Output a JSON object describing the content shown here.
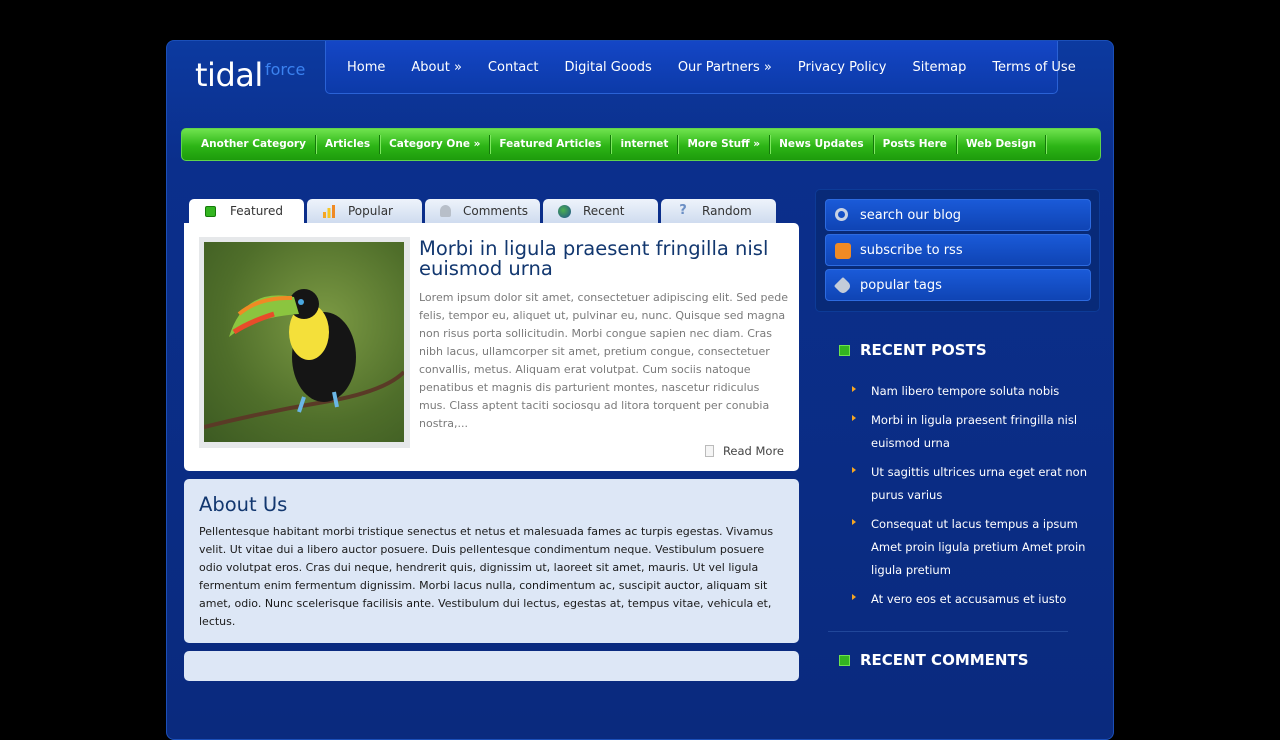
{
  "logo": {
    "main": "tidal",
    "sub": "force"
  },
  "top_nav": [
    "Home",
    "About »",
    "Contact",
    "Digital Goods",
    "Our Partners »",
    "Privacy Policy",
    "Sitemap",
    "Terms of Use"
  ],
  "category_nav": [
    "Another Category",
    "Articles",
    "Category One »",
    "Featured Articles",
    "internet",
    "More Stuff »",
    "News Updates",
    "Posts Here",
    "Web Design"
  ],
  "tabs": [
    "Featured",
    "Popular",
    "Comments",
    "Recent",
    "Random"
  ],
  "featured": {
    "title": "Morbi in ligula praesent fringilla nisl euismod urna",
    "excerpt": "Lorem ipsum dolor sit amet, consectetuer adipiscing elit. Sed pede felis, tempor eu, aliquet ut, pulvinar eu, nunc. Quisque sed magna non risus porta sollicitudin. Morbi congue sapien nec diam. Cras nibh lacus, ullamcorper sit amet, pretium congue, consectetuer convallis, metus. Aliquam erat volutpat. Cum sociis natoque penatibus et magnis dis parturient montes, nascetur ridiculus mus. Class aptent taciti sociosqu ad litora torquent per conubia nostra,...",
    "read_more": "Read More"
  },
  "about": {
    "title": "About Us",
    "text": "Pellentesque habitant morbi tristique senectus et netus et malesuada fames ac turpis egestas. Vivamus velit. Ut vitae dui a libero auctor posuere. Duis pellentesque condimentum neque. Vestibulum posuere odio volutpat eros. Cras dui neque, hendrerit quis, dignissim ut, laoreet sit amet, mauris. Ut vel ligula fermentum enim fermentum dignissim. Morbi lacus nulla, condimentum ac, suscipit auctor, aliquam sit amet, odio. Nunc scelerisque facilisis ante. Vestibulum dui lectus, egestas at, tempus vitae, vehicula et, lectus."
  },
  "sidebar": {
    "buttons": [
      "search our blog",
      "subscribe to rss",
      "popular tags"
    ],
    "recent_posts_title": "RECENT POSTS",
    "recent_posts": [
      "Nam libero tempore soluta nobis",
      "Morbi in ligula praesent fringilla nisl euismod urna",
      "Ut sagittis ultrices urna eget erat non purus varius",
      "Consequat ut lacus tempus a ipsum Amet proin ligula pretium Amet proin ligula pretium",
      "At vero eos et accusamus et iusto"
    ],
    "recent_comments_title": "RECENT COMMENTS"
  },
  "colors": {
    "nav_blue": "#0c3aa8",
    "category_green": "#2db516",
    "background": "#000000"
  }
}
